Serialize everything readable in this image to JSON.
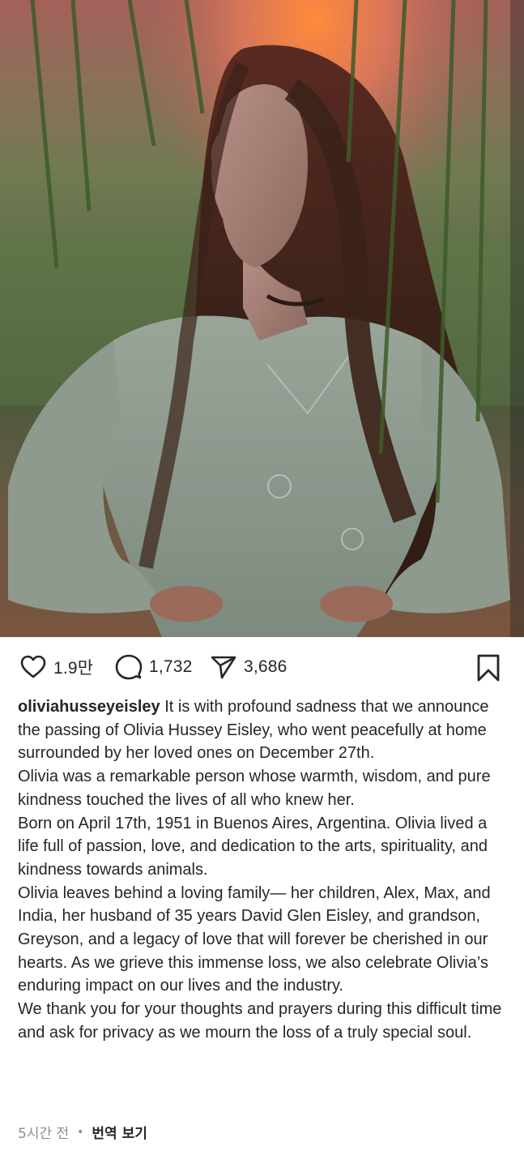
{
  "post": {
    "image_description_icon": "portrait-photo",
    "likes": "1.9만",
    "comments": "1,732",
    "shares": "3,686"
  },
  "caption": {
    "username": "oliviahusseyeisley",
    "paragraphs": [
      "It is with profound sadness that we announce the passing of Olivia Hussey Eisley, who went peacefully at home surrounded by her loved ones on December 27th.",
      "Olivia was a remarkable person whose warmth, wisdom, and pure kindness touched the lives of all who knew her.",
      "Born on April 17th, 1951 in Buenos Aires, Argentina. Olivia lived a life full of passion, love, and dedication to the arts, spirituality, and kindness towards animals.",
      "Olivia leaves behind a loving family— her children, Alex, Max, and India, her husband of 35 years David Glen Eisley, and grandson, Greyson, and a legacy of love that will forever be cherished in our hearts. As we grieve this immense loss, we also celebrate Olivia’s enduring impact on our lives and the industry.",
      "We thank you for your thoughts and prayers during this difficult time and ask for privacy as we mourn the loss of a truly special soul."
    ]
  },
  "meta": {
    "time_ago": "5시간 전",
    "separator": "•",
    "translate_label": "번역 보기"
  },
  "colors": {
    "text": "#262626",
    "muted": "#8e8e8e",
    "background": "#ffffff"
  }
}
